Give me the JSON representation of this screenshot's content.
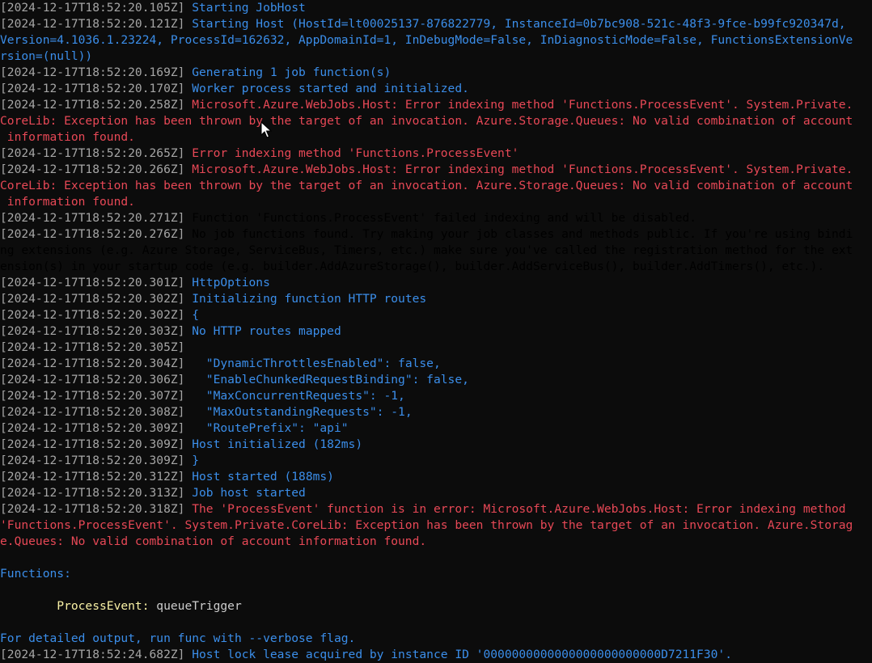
{
  "colors": {
    "background": "#0c0c0c",
    "timestamp": "#a6a6a6",
    "info": "#3b8eea",
    "error": "#e74856",
    "warning": "#f9f1a5",
    "plain": "#cccccc"
  },
  "lines": [
    {
      "ts": "[2024-12-17T18:52:20.105Z] ",
      "text": "Starting JobHost",
      "level": "info"
    },
    {
      "ts": "[2024-12-17T18:52:20.121Z] ",
      "text": "Starting Host (HostId=lt00025137-876822779, InstanceId=0b7bc908-521c-48f3-9fce-b99fc920347d,",
      "level": "info"
    },
    {
      "ts": "",
      "text": "Version=4.1036.1.23224, ProcessId=162632, AppDomainId=1, InDebugMode=False, InDiagnosticMode=False, FunctionsExtensionVe",
      "level": "info"
    },
    {
      "ts": "",
      "text": "rsion=(null))",
      "level": "info"
    },
    {
      "ts": "[2024-12-17T18:52:20.169Z] ",
      "text": "Generating 1 job function(s)",
      "level": "info"
    },
    {
      "ts": "[2024-12-17T18:52:20.170Z] ",
      "text": "Worker process started and initialized.",
      "level": "info"
    },
    {
      "ts": "[2024-12-17T18:52:20.258Z] ",
      "text": "Microsoft.Azure.WebJobs.Host: Error indexing method 'Functions.ProcessEvent'. System.Private.",
      "level": "error"
    },
    {
      "ts": "",
      "text": "CoreLib: Exception has been thrown by the target of an invocation. Azure.Storage.Queues: No valid combination of account",
      "level": "error"
    },
    {
      "ts": "",
      "text": " information found.",
      "level": "error"
    },
    {
      "ts": "[2024-12-17T18:52:20.265Z] ",
      "text": "Error indexing method 'Functions.ProcessEvent'",
      "level": "error"
    },
    {
      "ts": "[2024-12-17T18:52:20.266Z] ",
      "text": "Microsoft.Azure.WebJobs.Host: Error indexing method 'Functions.ProcessEvent'. System.Private.",
      "level": "error"
    },
    {
      "ts": "",
      "text": "CoreLib: Exception has been thrown by the target of an invocation. Azure.Storage.Queues: No valid combination of account",
      "level": "error"
    },
    {
      "ts": "",
      "text": " information found.",
      "level": "error"
    },
    {
      "ts": "[2024-12-17T18:52:20.271Z] ",
      "text": "Function 'Functions.ProcessEvent' failed indexing and will be disabled.",
      "level": "warning"
    },
    {
      "ts": "[2024-12-17T18:52:20.276Z] ",
      "text": "No job functions found. Try making your job classes and methods public. If you're using bindi",
      "level": "warning"
    },
    {
      "ts": "",
      "text": "ng extensions (e.g. Azure Storage, ServiceBus, Timers, etc.) make sure you've called the registration method for the ext",
      "level": "warning"
    },
    {
      "ts": "",
      "text": "ension(s) in your startup code (e.g. builder.AddAzureStorage(), builder.AddServiceBus(), builder.AddTimers(), etc.).",
      "level": "warning"
    },
    {
      "ts": "[2024-12-17T18:52:20.301Z] ",
      "text": "HttpOptions",
      "level": "info"
    },
    {
      "ts": "[2024-12-17T18:52:20.302Z] ",
      "text": "Initializing function HTTP routes",
      "level": "info"
    },
    {
      "ts": "[2024-12-17T18:52:20.302Z] ",
      "text": "{",
      "level": "info"
    },
    {
      "ts": "[2024-12-17T18:52:20.303Z] ",
      "text": "No HTTP routes mapped",
      "level": "info"
    },
    {
      "ts": "[2024-12-17T18:52:20.305Z]",
      "text": "",
      "level": "info"
    },
    {
      "ts": "[2024-12-17T18:52:20.304Z] ",
      "text": "  \"DynamicThrottlesEnabled\": false,",
      "level": "info"
    },
    {
      "ts": "[2024-12-17T18:52:20.306Z] ",
      "text": "  \"EnableChunkedRequestBinding\": false,",
      "level": "info"
    },
    {
      "ts": "[2024-12-17T18:52:20.307Z] ",
      "text": "  \"MaxConcurrentRequests\": -1,",
      "level": "info"
    },
    {
      "ts": "[2024-12-17T18:52:20.308Z] ",
      "text": "  \"MaxOutstandingRequests\": -1,",
      "level": "info"
    },
    {
      "ts": "[2024-12-17T18:52:20.309Z] ",
      "text": "  \"RoutePrefix\": \"api\"",
      "level": "info"
    },
    {
      "ts": "[2024-12-17T18:52:20.309Z] ",
      "text": "Host initialized (182ms)",
      "level": "info"
    },
    {
      "ts": "[2024-12-17T18:52:20.309Z] ",
      "text": "}",
      "level": "info"
    },
    {
      "ts": "[2024-12-17T18:52:20.312Z] ",
      "text": "Host started (188ms)",
      "level": "info"
    },
    {
      "ts": "[2024-12-17T18:52:20.313Z] ",
      "text": "Job host started",
      "level": "info"
    },
    {
      "ts": "[2024-12-17T18:52:20.318Z] ",
      "text": "The 'ProcessEvent' function is in error: Microsoft.Azure.WebJobs.Host: Error indexing method",
      "level": "error"
    },
    {
      "ts": "",
      "text": "'Functions.ProcessEvent'. System.Private.CoreLib: Exception has been thrown by the target of an invocation. Azure.Storag",
      "level": "error"
    },
    {
      "ts": "",
      "text": "e.Queues: No valid combination of account information found.",
      "level": "error"
    },
    {
      "ts": "",
      "text": "",
      "level": "plain"
    },
    {
      "ts": "",
      "text": "Functions:",
      "level": "info"
    },
    {
      "ts": "",
      "text": "",
      "level": "plain"
    },
    {
      "ts": "",
      "text": "",
      "level": "function",
      "func_name": "        ProcessEvent:",
      "func_trigger": " queueTrigger"
    },
    {
      "ts": "",
      "text": "",
      "level": "plain"
    },
    {
      "ts": "",
      "text": "For detailed output, run func with --verbose flag.",
      "level": "info"
    },
    {
      "ts": "[2024-12-17T18:52:24.682Z] ",
      "text": "Host lock lease acquired by instance ID '0000000000000000000000000D7211F30'.",
      "level": "info"
    }
  ]
}
